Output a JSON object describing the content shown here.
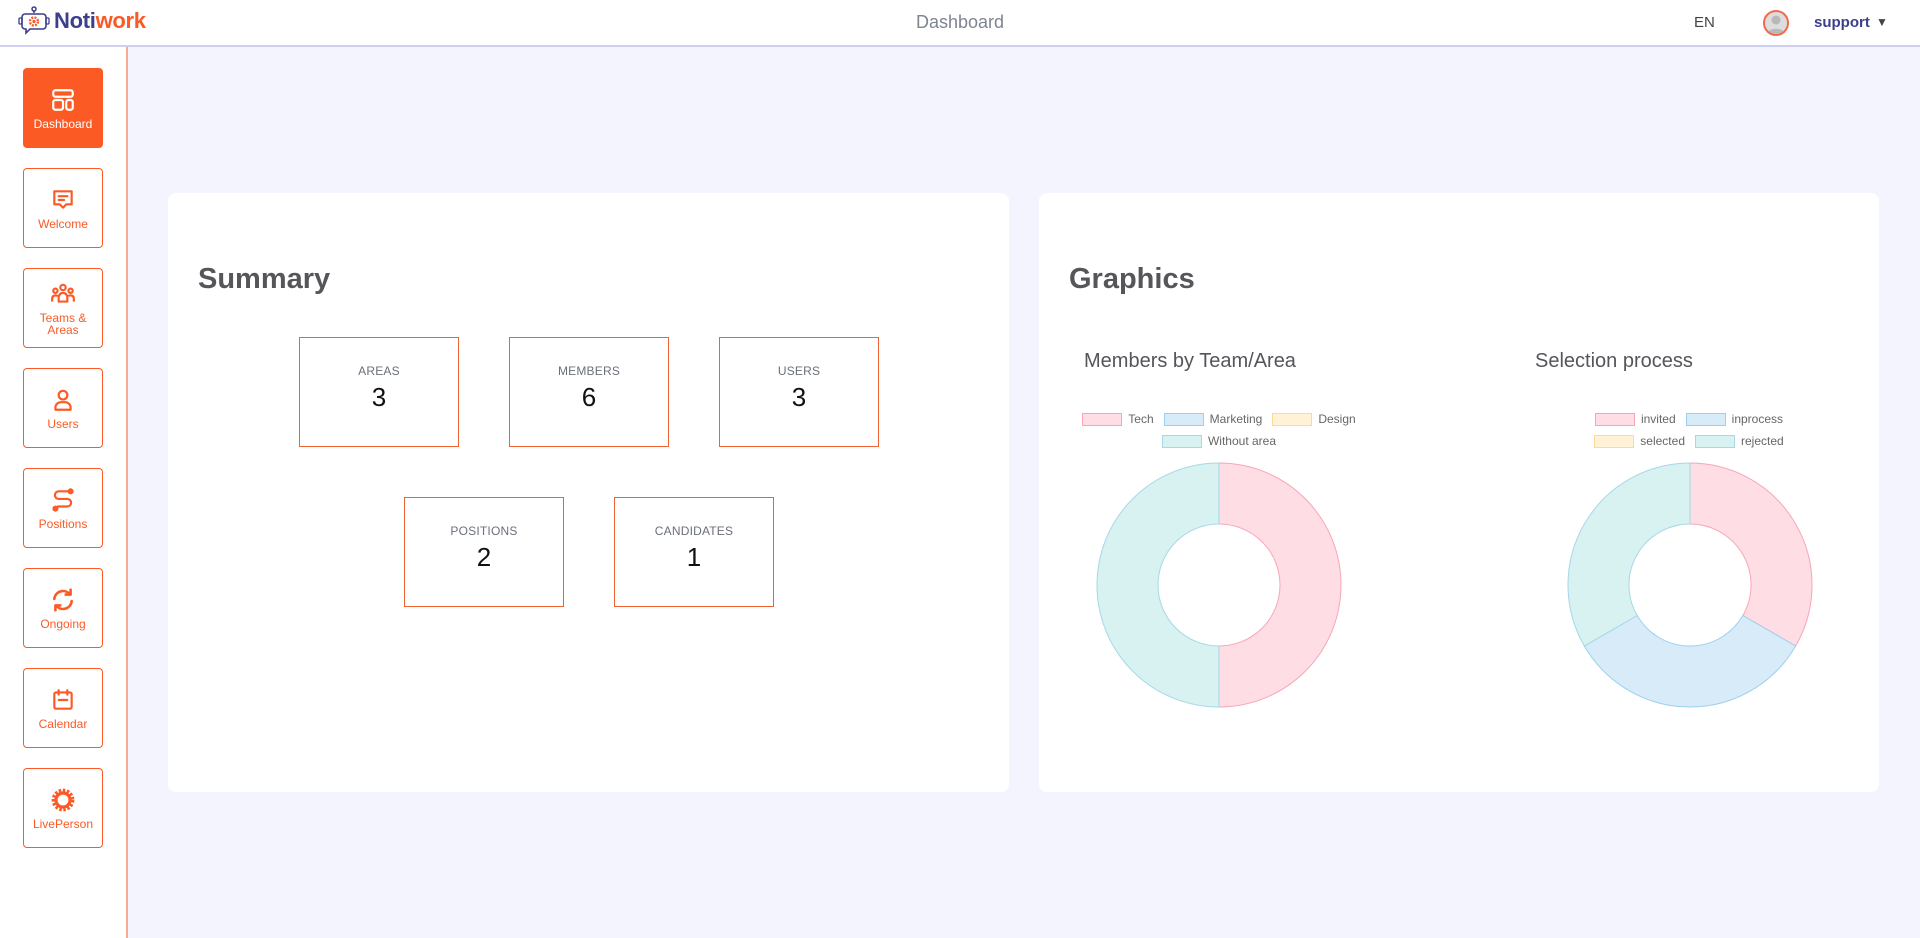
{
  "header": {
    "logo": {
      "part1": "Noti",
      "part2": "work"
    },
    "title": "Dashboard",
    "language": "EN",
    "user": "support",
    "caret": "▼"
  },
  "sidebar": {
    "items": [
      {
        "label": "Dashboard",
        "icon": "dashboard-icon",
        "active": true
      },
      {
        "label": "Welcome",
        "icon": "message-icon",
        "active": false
      },
      {
        "label": "Teams & Areas",
        "icon": "team-icon",
        "active": false
      },
      {
        "label": "Users",
        "icon": "user-icon",
        "active": false
      },
      {
        "label": "Positions",
        "icon": "route-icon",
        "active": false
      },
      {
        "label": "Ongoing",
        "icon": "refresh-icon",
        "active": false
      },
      {
        "label": "Calendar",
        "icon": "calendar-icon",
        "active": false
      },
      {
        "label": "LivePerson",
        "icon": "gear-icon",
        "active": false
      }
    ]
  },
  "summary": {
    "title": "Summary",
    "stats": [
      {
        "label": "AREAS",
        "value": "3"
      },
      {
        "label": "MEMBERS",
        "value": "6"
      },
      {
        "label": "USERS",
        "value": "3"
      },
      {
        "label": "POSITIONS",
        "value": "2"
      },
      {
        "label": "CANDIDATES",
        "value": "1"
      }
    ]
  },
  "graphics": {
    "title": "Graphics"
  },
  "colors": {
    "accent": "#fc5a25",
    "brand_dark": "#3c3f8a",
    "pink_fill": "#ffdde4",
    "pink_border": "#f7a6b8",
    "blue_fill": "#d7ebf9",
    "blue_border": "#9dd0ee",
    "yellow_fill": "#fff2d6",
    "yellow_border": "#f9dc9a",
    "teal_fill": "#d8f1f1",
    "teal_border": "#a6d8e8"
  },
  "chart_data": [
    {
      "type": "pie",
      "variant": "doughnut",
      "title": "Members by Team/Area",
      "categories": [
        "Tech",
        "Marketing",
        "Design",
        "Without area"
      ],
      "values": [
        3,
        0,
        0,
        3
      ],
      "legend": "top"
    },
    {
      "type": "pie",
      "variant": "doughnut",
      "title": "Selection process",
      "categories": [
        "invited",
        "inprocess",
        "selected",
        "rejected"
      ],
      "values": [
        1,
        1,
        0,
        1
      ],
      "legend": "top"
    }
  ]
}
